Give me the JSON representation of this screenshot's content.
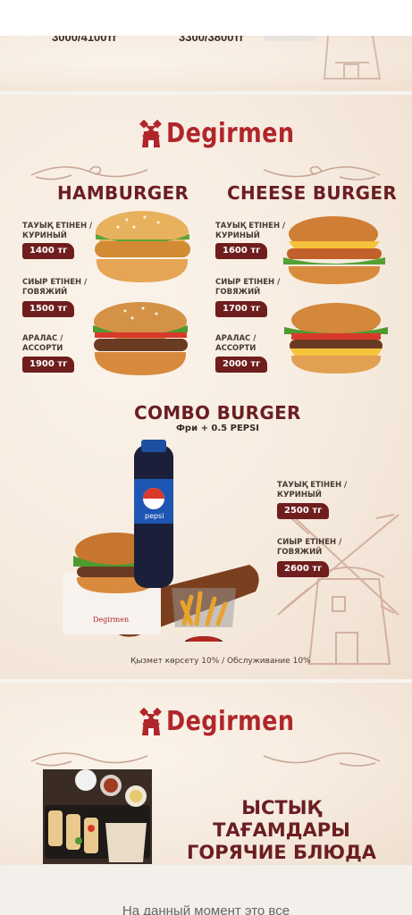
{
  "prev_card": {
    "price_left": "3000/4100тг",
    "price_right": "3300/3800тг"
  },
  "logo": {
    "text": "Degirmen"
  },
  "hamburger": {
    "title": "HAMBURGER",
    "items": [
      {
        "label_kz": "ТАУЫҚ ЕТІНЕН /",
        "label_ru": "КУРИНЫЙ",
        "price": "1400 тг"
      },
      {
        "label_kz": "СИЫР ЕТІНЕН /",
        "label_ru": "ГОВЯЖИЙ",
        "price": "1500 тг"
      },
      {
        "label_kz": "АРАЛАС /",
        "label_ru": "АССОРТИ",
        "price": "1900 тг"
      }
    ]
  },
  "cheeseburger": {
    "title": "CHEESE BURGER",
    "items": [
      {
        "label_kz": "ТАУЫҚ ЕТІНЕН /",
        "label_ru": "КУРИНЫЙ",
        "price": "1600 тг"
      },
      {
        "label_kz": "СИЫР ЕТІНЕН /",
        "label_ru": "ГОВЯЖИЙ",
        "price": "1700 тг"
      },
      {
        "label_kz": "АРАЛАС /",
        "label_ru": "АССОРТИ",
        "price": "2000 тг"
      }
    ]
  },
  "combo": {
    "title": "COMBO BURGER",
    "subtitle": "Фри + 0.5 PEPSI",
    "items": [
      {
        "label_kz": "ТАУЫҚ ЕТІНЕН /",
        "label_ru": "КУРИНЫЙ",
        "price": "2500 тг"
      },
      {
        "label_kz": "СИЫР ЕТІНЕН /",
        "label_ru": "ГОВЯЖИЙ",
        "price": "2600 тг"
      }
    ],
    "bottle_text": "pepsi",
    "box_text": "Degirmen"
  },
  "service_note": "Қызмет көрсету 10%  /  Обслуживание 10%",
  "hot_dishes": {
    "title_kz": "ЫСТЫҚ ТАҒАМДАРЫ",
    "title_ru": "ГОРЯЧИЕ БЛЮДА"
  },
  "footer_text": "На данный момент это все",
  "colors": {
    "brand_red": "#b0262b",
    "title_maroon": "#6b1e22",
    "price_tag": "#6f1d1d",
    "card_bg": "#f6ebdf"
  },
  "icons": [
    "windmill-logo-icon",
    "windmill-watermark-icon",
    "flourish-ornament"
  ]
}
